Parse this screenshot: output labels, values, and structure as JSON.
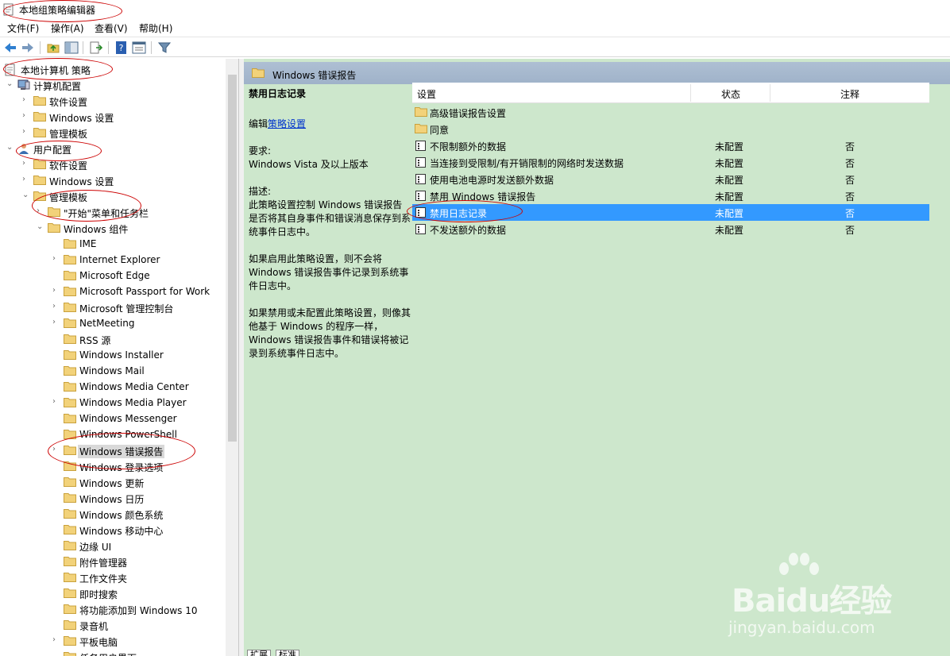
{
  "window": {
    "title": "本地组策略编辑器"
  },
  "menu": [
    "文件(F)",
    "操作(A)",
    "查看(V)",
    "帮助(H)"
  ],
  "tree": [
    {
      "label": "本地计算机 策略",
      "level": 0,
      "arrow": "",
      "icon": "policy-doc"
    },
    {
      "label": "计算机配置",
      "level": 1,
      "arrow": "open",
      "icon": "computer"
    },
    {
      "label": "软件设置",
      "level": 2,
      "arrow": "closed",
      "icon": "folder"
    },
    {
      "label": "Windows 设置",
      "level": 2,
      "arrow": "closed",
      "icon": "folder"
    },
    {
      "label": "管理模板",
      "level": 2,
      "arrow": "closed",
      "icon": "folder"
    },
    {
      "label": "用户配置",
      "level": 1,
      "arrow": "open",
      "icon": "user"
    },
    {
      "label": "软件设置",
      "level": 2,
      "arrow": "closed",
      "icon": "folder"
    },
    {
      "label": "Windows 设置",
      "level": 2,
      "arrow": "closed",
      "icon": "folder"
    },
    {
      "label": "管理模板",
      "level": 2,
      "arrow": "open",
      "icon": "folder"
    },
    {
      "label": "\"开始\"菜单和任务栏",
      "level": 3,
      "arrow": "closed",
      "icon": "folder"
    },
    {
      "label": "Windows 组件",
      "level": 3,
      "arrow": "open",
      "icon": "folder"
    },
    {
      "label": "IME",
      "level": 4,
      "arrow": "",
      "icon": "folder"
    },
    {
      "label": "Internet Explorer",
      "level": 4,
      "arrow": "closed",
      "icon": "folder"
    },
    {
      "label": "Microsoft Edge",
      "level": 4,
      "arrow": "",
      "icon": "folder"
    },
    {
      "label": "Microsoft Passport for Work",
      "level": 4,
      "arrow": "closed",
      "icon": "folder"
    },
    {
      "label": "Microsoft 管理控制台",
      "level": 4,
      "arrow": "closed",
      "icon": "folder"
    },
    {
      "label": "NetMeeting",
      "level": 4,
      "arrow": "closed",
      "icon": "folder"
    },
    {
      "label": "RSS 源",
      "level": 4,
      "arrow": "",
      "icon": "folder"
    },
    {
      "label": "Windows Installer",
      "level": 4,
      "arrow": "",
      "icon": "folder"
    },
    {
      "label": "Windows Mail",
      "level": 4,
      "arrow": "",
      "icon": "folder"
    },
    {
      "label": "Windows Media Center",
      "level": 4,
      "arrow": "",
      "icon": "folder"
    },
    {
      "label": "Windows Media Player",
      "level": 4,
      "arrow": "closed",
      "icon": "folder"
    },
    {
      "label": "Windows Messenger",
      "level": 4,
      "arrow": "",
      "icon": "folder"
    },
    {
      "label": "Windows PowerShell",
      "level": 4,
      "arrow": "",
      "icon": "folder"
    },
    {
      "label": "Windows 错误报告",
      "level": 4,
      "arrow": "closed",
      "icon": "folder",
      "selected": true
    },
    {
      "label": "Windows 登录选项",
      "level": 4,
      "arrow": "",
      "icon": "folder"
    },
    {
      "label": "Windows 更新",
      "level": 4,
      "arrow": "",
      "icon": "folder"
    },
    {
      "label": "Windows 日历",
      "level": 4,
      "arrow": "",
      "icon": "folder"
    },
    {
      "label": "Windows 颜色系统",
      "level": 4,
      "arrow": "",
      "icon": "folder"
    },
    {
      "label": "Windows 移动中心",
      "level": 4,
      "arrow": "",
      "icon": "folder"
    },
    {
      "label": "边缘 UI",
      "level": 4,
      "arrow": "",
      "icon": "folder"
    },
    {
      "label": "附件管理器",
      "level": 4,
      "arrow": "",
      "icon": "folder"
    },
    {
      "label": "工作文件夹",
      "level": 4,
      "arrow": "",
      "icon": "folder"
    },
    {
      "label": "即时搜索",
      "level": 4,
      "arrow": "",
      "icon": "folder"
    },
    {
      "label": "将功能添加到 Windows 10",
      "level": 4,
      "arrow": "",
      "icon": "folder"
    },
    {
      "label": "录音机",
      "level": 4,
      "arrow": "",
      "icon": "folder"
    },
    {
      "label": "平板电脑",
      "level": 4,
      "arrow": "closed",
      "icon": "folder"
    },
    {
      "label": "任务用户界面",
      "level": 4,
      "arrow": "",
      "icon": "folder"
    }
  ],
  "right": {
    "header": "Windows 错误报告",
    "description": {
      "title": "禁用日志记录",
      "edit_prefix": "编辑",
      "edit_link": "策略设置",
      "req_label": "要求:",
      "req_value": "Windows Vista 及以上版本",
      "desc_label": "描述:",
      "desc_p1": "此策略设置控制 Windows 错误报告是否将其自身事件和错误消息保存到系统事件日志中。",
      "desc_p2": "如果启用此策略设置，则不会将 Windows 错误报告事件记录到系统事件日志中。",
      "desc_p3": "如果禁用或未配置此策略设置，则像其他基于 Windows 的程序一样，Windows 错误报告事件和错误将被记录到系统事件日志中。"
    },
    "columns": {
      "name": "设置",
      "state": "状态",
      "comment": "注释"
    },
    "rows": [
      {
        "name": "高级错误报告设置",
        "state": "",
        "comment": "",
        "icon": "folder"
      },
      {
        "name": "同意",
        "state": "",
        "comment": "",
        "icon": "folder"
      },
      {
        "name": "不限制额外的数据",
        "state": "未配置",
        "comment": "否",
        "icon": "setting"
      },
      {
        "name": "当连接到受限制/有开销限制的网络时发送数据",
        "state": "未配置",
        "comment": "否",
        "icon": "setting"
      },
      {
        "name": "使用电池电源时发送额外数据",
        "state": "未配置",
        "comment": "否",
        "icon": "setting"
      },
      {
        "name": "禁用 Windows 错误报告",
        "state": "未配置",
        "comment": "否",
        "icon": "setting"
      },
      {
        "name": "禁用日志记录",
        "state": "未配置",
        "comment": "否",
        "icon": "setting",
        "selected": true
      },
      {
        "name": "不发送额外的数据",
        "state": "未配置",
        "comment": "否",
        "icon": "setting"
      }
    ]
  },
  "tabs": [
    "扩展",
    "标准"
  ],
  "watermark": {
    "logo": "Baidu经验",
    "url": "jingyan.baidu.com"
  },
  "colors": {
    "pane_bg": "#cde7cc",
    "header_bg": "#a7b9cf",
    "selection": "#3399ff",
    "annotation": "#cc0000"
  }
}
